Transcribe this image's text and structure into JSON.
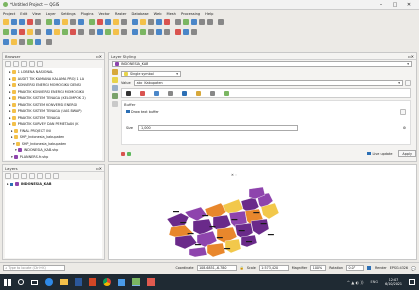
{
  "window": {
    "title": "*Untitled Project — QGIS",
    "controls": [
      "–",
      "□",
      "✕"
    ]
  },
  "menubar": [
    "Project",
    "Edit",
    "View",
    "Layer",
    "Settings",
    "Plugins",
    "Vector",
    "Raster",
    "Database",
    "Web",
    "Mesh",
    "Processing",
    "Help"
  ],
  "browser": {
    "title": "Browser",
    "items": [
      "1 LOBENA NASIONAL",
      "AUDIT TIK KAMIANA KALAMA PROJ 1 LA",
      "KONVERSI ENERGI MOMOGIKU DENSI",
      "PRAKTIK KONVERSI ENERGI MOMOGIKU",
      "PRAKTIK SISTEM TENAGA (KELOMPOK 2)",
      "PRAKTIK SISTEM KONVERSI ENERGI",
      "PRAKTIK SISTEM TENAGA (UAS BWAP)",
      "PRAKTIK SISTEM TENAGA",
      "PRAKTIK SURVEY DAN PEMETAAN (K",
      "FINAL PROJECT INI",
      "SHP_Indonesia_kabupaten",
      "SHP_Indonesia_kabupaten",
      "INDONESIA_KAB.shp",
      "PLANNERS.fr.shp"
    ]
  },
  "layers": {
    "title": "Layers",
    "items": [
      {
        "label": "INDONESIA_KAB",
        "checked": true
      }
    ]
  },
  "styling": {
    "title": "Layer Styling",
    "layer_select": "INDONESIA_KAB",
    "renderer": "Single symbol",
    "value_label": "Value",
    "value_field": "Kabupaten",
    "buffer_checkbox": "Draw text buffer",
    "size_label": "Size",
    "size_value": "1,000",
    "live_update": "Live update",
    "apply": "Apply",
    "history_label": "History",
    "tab_icons": [
      "abc-icon",
      "format-icon",
      "buffer-icon",
      "background-icon",
      "shadow-icon",
      "callout-icon",
      "placement-icon",
      "rendering-icon"
    ]
  },
  "status": {
    "search_placeholder": "Type to locate (Ctrl+K)",
    "coordinate_label": "Coordinate",
    "coordinate_value": "108.6851,-6.780",
    "scale_label": "Scale",
    "scale_value": "1:573,420",
    "magnifier_label": "Magnifier",
    "magnifier_value": "100%",
    "rotation_label": "Rotation",
    "rotation_value": "0.0°",
    "render_label": "Render",
    "crs": "EPSG:4326"
  },
  "taskbar": {
    "time": "12:07",
    "date": "6/10/2021",
    "lang": "ENG"
  },
  "colors": {
    "ui_bg": "#eceae6",
    "map_bg": "#ffffff",
    "region_purple": "#6a2a8a",
    "region_violet": "#8e44ad",
    "region_orange": "#e8872c",
    "region_yellow": "#f2c84b",
    "taskbar": "#1f2a33"
  }
}
